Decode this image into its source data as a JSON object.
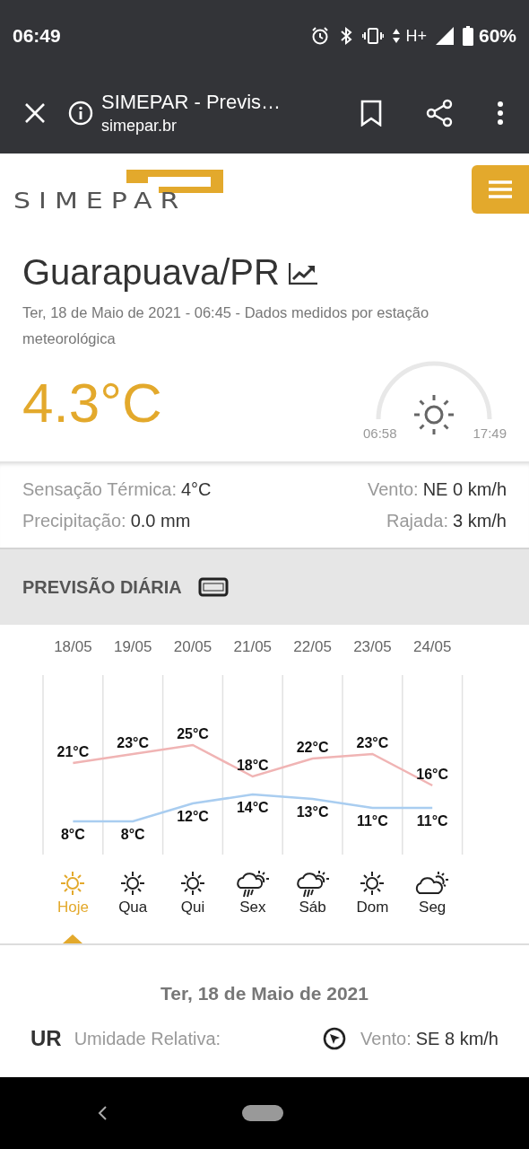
{
  "status_bar": {
    "time": "06:49",
    "network": "H+",
    "battery": "60%"
  },
  "browser": {
    "title": "SIMEPAR - Previs…",
    "url": "simepar.br"
  },
  "header": {
    "logo": "SIMEPAR"
  },
  "location": {
    "city": "Guarapuava/PR",
    "subtitle": "Ter, 18 de Maio de 2021 - 06:45 - Dados medidos por estação meteorológica",
    "temperature": "4.3°C",
    "sunrise": "06:58",
    "sunset": "17:49"
  },
  "details": [
    {
      "label": "Sensação Térmica:",
      "value": "4°C"
    },
    {
      "label": "Vento:",
      "value": "NE 0 km/h"
    },
    {
      "label": "Precipitação:",
      "value": "0.0 mm"
    },
    {
      "label": "Rajada:",
      "value": "3 km/h"
    }
  ],
  "daily": {
    "title": "PREVISÃO DIÁRIA",
    "chart_data": {
      "type": "line",
      "categories": [
        "18/05",
        "19/05",
        "20/05",
        "21/05",
        "22/05",
        "23/05",
        "24/05"
      ],
      "series": [
        {
          "color": "#f0b4b4",
          "values": [
            21,
            23,
            25,
            18,
            22,
            23,
            16
          ],
          "value_labels": [
            "21°C",
            "23°C",
            "25°C",
            "18°C",
            "22°C",
            "23°C",
            "16°C"
          ]
        },
        {
          "color": "#a9cdf0",
          "values": [
            8,
            8,
            12,
            14,
            13,
            11,
            11
          ],
          "value_labels": [
            "8°C",
            "8°C",
            "12°C",
            "14°C",
            "13°C",
            "11°C",
            "11°C"
          ]
        }
      ]
    },
    "days": [
      {
        "label": "Hoje",
        "kind": "sunny",
        "selected": true
      },
      {
        "label": "Qua",
        "kind": "sunny",
        "selected": false
      },
      {
        "label": "Qui",
        "kind": "sunny",
        "selected": false
      },
      {
        "label": "Sex",
        "kind": "rain",
        "selected": false
      },
      {
        "label": "Sáb",
        "kind": "rain",
        "selected": false
      },
      {
        "label": "Dom",
        "kind": "sunny",
        "selected": false
      },
      {
        "label": "Seg",
        "kind": "cloudy",
        "selected": false
      }
    ]
  },
  "day_detail": {
    "date": "Ter, 18 de Maio de 2021",
    "humidity_abbr": "UR",
    "humidity_label": "Umidade Relativa:",
    "wind_label": "Vento:",
    "wind_value": "SE 8 km/h"
  }
}
